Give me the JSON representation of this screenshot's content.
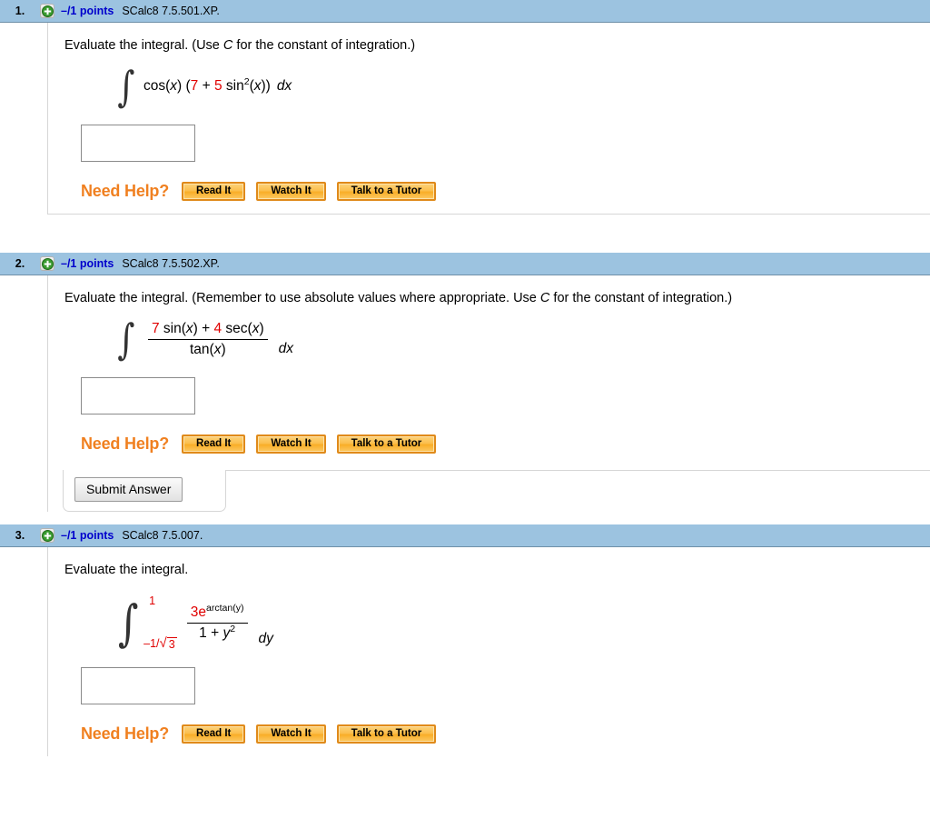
{
  "page": {
    "accent_header_bg": "#9cc3e0",
    "points_color": "#0000cc",
    "need_help_color": "#f08020",
    "math_highlight_color": "#e00000"
  },
  "common": {
    "plus_icon": "plus-circle-icon",
    "need_help_label": "Need Help?",
    "help_buttons": [
      {
        "id": "read-it",
        "label": "Read It"
      },
      {
        "id": "watch-it",
        "label": "Watch It"
      },
      {
        "id": "talk-to-a-tutor",
        "label": "Talk to a Tutor"
      }
    ],
    "answer_placeholder": "",
    "answer_value": "",
    "submit_label": "Submit Answer"
  },
  "questions": [
    {
      "number": "1.",
      "points": "–/1 points",
      "code": "SCalc8 7.5.501.XP.",
      "prompt_parts": {
        "a": "Evaluate the integral. (Use ",
        "b": "C",
        "c": " for the constant of integration.)"
      },
      "integral": {
        "kind": "indefinite",
        "integrand_tokens": [
          {
            "t": "cos(",
            "style": "plain"
          },
          {
            "t": "x",
            "style": "ital"
          },
          {
            "t": ") (",
            "style": "plain"
          },
          {
            "t": "7",
            "style": "red"
          },
          {
            "t": " + ",
            "style": "plain"
          },
          {
            "t": "5",
            "style": "red"
          },
          {
            "t": " sin",
            "style": "plain"
          },
          {
            "t": "2",
            "style": "sup"
          },
          {
            "t": "(",
            "style": "plain"
          },
          {
            "t": "x",
            "style": "ital"
          },
          {
            "t": "))",
            "style": "plain"
          }
        ],
        "differential": "dx"
      },
      "has_submit": false
    },
    {
      "number": "2.",
      "points": "–/1 points",
      "code": "SCalc8 7.5.502.XP.",
      "prompt_parts": {
        "a": "Evaluate the integral. (Remember to use absolute values where appropriate. Use ",
        "b": "C",
        "c": " for the constant of integration.)"
      },
      "integral": {
        "kind": "fraction",
        "numerator_tokens": [
          {
            "t": "7",
            "style": "red"
          },
          {
            "t": " sin(",
            "style": "plain"
          },
          {
            "t": "x",
            "style": "ital"
          },
          {
            "t": ") + ",
            "style": "plain"
          },
          {
            "t": "4",
            "style": "red"
          },
          {
            "t": " sec(",
            "style": "plain"
          },
          {
            "t": "x",
            "style": "ital"
          },
          {
            "t": ")",
            "style": "plain"
          }
        ],
        "denominator_tokens": [
          {
            "t": "tan(",
            "style": "plain"
          },
          {
            "t": "x",
            "style": "ital"
          },
          {
            "t": ")",
            "style": "plain"
          }
        ],
        "differential": "dx"
      },
      "has_submit": true
    },
    {
      "number": "3.",
      "points": "–/1 points",
      "code": "SCalc8 7.5.007.",
      "prompt_parts": {
        "a": "Evaluate the integral.",
        "b": "",
        "c": ""
      },
      "integral": {
        "kind": "definite-fraction",
        "upper_limit": "1",
        "lower_limit_prefix": "–1/",
        "lower_limit_radicand": "3",
        "radical_glyph": "√",
        "numerator_tokens": [
          {
            "t": "3",
            "style": "red"
          },
          {
            "t": "e",
            "style": "plain"
          },
          {
            "t": "arctan(y)",
            "style": "sup"
          }
        ],
        "denominator_tokens": [
          {
            "t": "1 + ",
            "style": "plain"
          },
          {
            "t": "y",
            "style": "ital"
          },
          {
            "t": "2",
            "style": "sup"
          }
        ],
        "differential": "dy"
      },
      "has_submit": false
    }
  ]
}
